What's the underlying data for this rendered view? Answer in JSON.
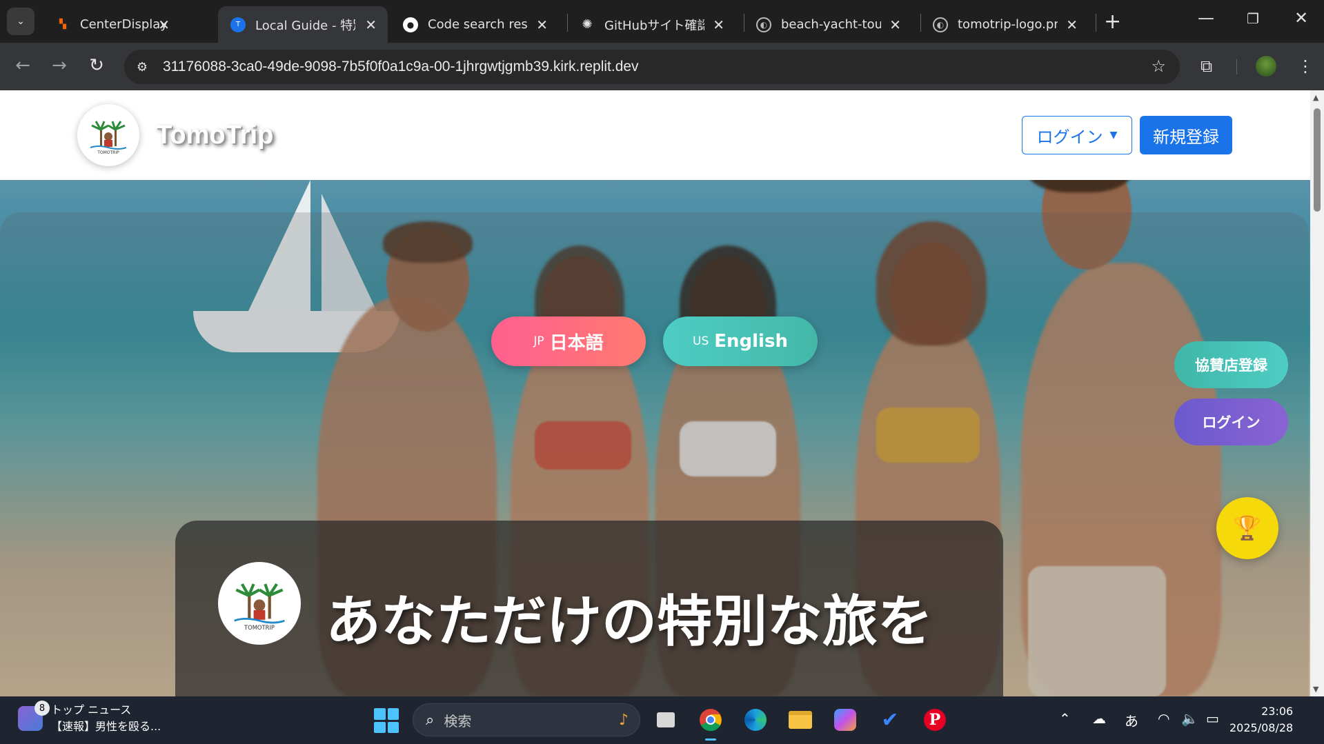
{
  "browser": {
    "tabs": [
      {
        "title": "CenterDisplay - Replit",
        "favicon": "replit-icon",
        "active": false
      },
      {
        "title": "Local Guide - 特別な旅",
        "favicon": "tomotrip-favicon",
        "active": true
      },
      {
        "title": "Code search results",
        "favicon": "github-icon",
        "active": false
      },
      {
        "title": "GitHubサイト確認手順",
        "favicon": "chatgpt-icon",
        "active": false
      },
      {
        "title": "beach-yacht-tourism",
        "favicon": "globe-icon",
        "active": false
      },
      {
        "title": "tomotrip-logo.png",
        "favicon": "globe-icon",
        "active": false
      }
    ],
    "url": "31176088-3ca0-49de-9098-7b5f0f0a1c9a-00-1jhrgwtjgmb39.kirk.replit.dev"
  },
  "site": {
    "brand": "TomoTrip",
    "logo_text": "TOMOTRIP",
    "header": {
      "login_label": "ログイン",
      "signup_label": "新規登録"
    },
    "lang": {
      "jp_code": "JP",
      "jp_label": "日本語",
      "en_code": "US",
      "en_label": "English"
    },
    "side": {
      "partner_label": "協賛店登録",
      "login_label": "ログイン",
      "trophy_icon": "trophy-icon"
    },
    "hero": {
      "title": "あなただけの特別な旅を"
    }
  },
  "taskbar": {
    "news_count": "8",
    "news_title": "トップ ニュース",
    "news_headline": "【速報】男性を殴る...",
    "search_placeholder": "検索",
    "ime": "あ",
    "time": "23:06",
    "date": "2025/08/28"
  },
  "colors": {
    "accent_blue": "#1a73e8",
    "lang_jp": "#ff5f8f",
    "lang_en": "#4ecdc4",
    "partner": "#3fb6a8",
    "side_login": "#6a5acd",
    "trophy": "#f5d90a"
  }
}
